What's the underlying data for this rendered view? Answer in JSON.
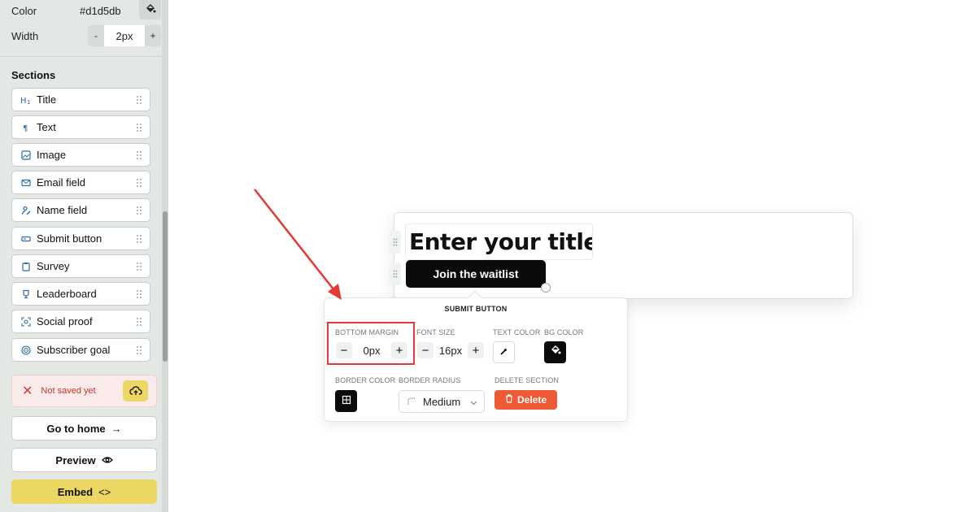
{
  "colors": {
    "accent_yellow": "#ecd764",
    "danger": "#ee5a36",
    "annotation_red": "#e53935",
    "sidebar_bg": "#e3e8e5"
  },
  "sidebar": {
    "color_label": "Color",
    "color_value": "#d1d5db",
    "width_label": "Width",
    "width_minus": "-",
    "width_value": "2px",
    "width_plus": "+",
    "sections_title": "Sections",
    "items": [
      {
        "label": "Title",
        "icon": "heading-icon"
      },
      {
        "label": "Text",
        "icon": "paragraph-icon"
      },
      {
        "label": "Image",
        "icon": "image-icon"
      },
      {
        "label": "Email field",
        "icon": "mail-icon"
      },
      {
        "label": "Name field",
        "icon": "user-edit-icon"
      },
      {
        "label": "Submit button",
        "icon": "button-icon"
      },
      {
        "label": "Survey",
        "icon": "clipboard-icon"
      },
      {
        "label": "Leaderboard",
        "icon": "trophy-icon"
      },
      {
        "label": "Social proof",
        "icon": "focus-icon"
      },
      {
        "label": "Subscriber goal",
        "icon": "target-icon"
      }
    ],
    "not_saved": "Not saved yet",
    "go_home": "Go to home",
    "go_home_sym": "→",
    "preview": "Preview",
    "embed": "Embed",
    "embed_sym": "<>"
  },
  "canvas": {
    "title_placeholder": "Enter your title",
    "join_button": "Join the waitlist"
  },
  "popover": {
    "title": "SUBMIT BUTTON",
    "bottom_margin_label": "BOTTOM MARGIN",
    "bottom_margin_value": "0px",
    "font_size_label": "FONT SIZE",
    "font_size_value": "16px",
    "text_color_label": "TEXT COLOR",
    "bg_color_label": "BG COLOR",
    "border_color_label": "BORDER COLOR",
    "border_radius_label": "BORDER RADIUS",
    "border_radius_value": "Medium",
    "delete_section_label": "DELETE SECTION",
    "delete_button": "Delete",
    "minus": "−",
    "plus": "+"
  }
}
